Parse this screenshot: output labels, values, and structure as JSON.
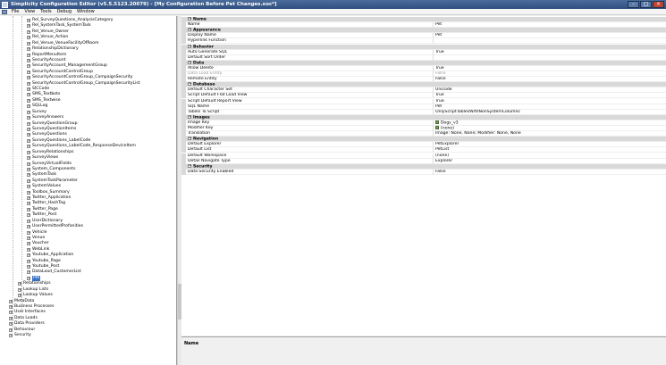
{
  "window": {
    "title": "Simplicity Configuration Editor (v5.5.5123.20079) - [My Configuration Before Pet Changes.xoc*]"
  },
  "menu": [
    "File",
    "View",
    "Tools",
    "Debug",
    "Window"
  ],
  "tree": {
    "tables": [
      "Rel_SurveyQuestions_AnalysisCategory",
      "Rel_SystemTask_SystemTask",
      "Rel_Venue_Owner",
      "Rel_Venue_Action",
      "Rel_Venue_VenueFacilityOfRoom",
      "RelationshipDictionary",
      "ReportMenuItem",
      "SecurityAccount",
      "SecurityAccount_ManagementGroup",
      "SecurityAccountControlGroup",
      "SecurityAccountControlGroup_CampaignSecurity",
      "SecurityAccountControlGroup_CampaignSecurityList",
      "SICCode",
      "SMS_Textbots",
      "SMS_Textwise",
      "SQLLog",
      "Survey",
      "SurveyAnswers",
      "SurveyQuestionGroup",
      "SurveyQuestionItems",
      "SurveyQuestions",
      "SurveyQuestions_LabelCode",
      "SurveyQuestions_LabelCode_ResponseDeviceItem",
      "SurveyRelationships",
      "SurveyViews",
      "SurveyVirtualFields",
      "System_Components",
      "SystemTask",
      "SystemTaskParameter",
      "SystemValues",
      "Toolbox_Summary",
      "Twitter_Application",
      "Twitter_HashTag",
      "Twitter_Page",
      "Twitter_Post",
      "UserDictionary",
      "UserPermittedProfanities",
      "Vehicle",
      "Venue",
      "Voucher",
      "WebLink",
      "Youtube_Application",
      "Youtube_Page",
      "Youtube_Post",
      "DataLoad_CustomerList",
      "Pet"
    ],
    "selected": "Pet",
    "groups": [
      "Relationships",
      "Lookup Lists",
      "Lookup Values"
    ],
    "root": [
      "MetaData",
      "Business Processes",
      "User Interfaces",
      "Data Loads",
      "Data Providers",
      "Behaviour",
      "Security"
    ]
  },
  "properties": [
    {
      "type": "cat",
      "label": "Name"
    },
    {
      "type": "prop",
      "label": "Name",
      "value": "Pet"
    },
    {
      "type": "cat",
      "label": "Appearance"
    },
    {
      "type": "prop",
      "label": "Display Name",
      "value": "Pet"
    },
    {
      "type": "prop",
      "label": "Hyperlink Function",
      "value": ""
    },
    {
      "type": "cat",
      "label": "Behavior"
    },
    {
      "type": "prop",
      "label": "Auto Generate SQL",
      "value": "True"
    },
    {
      "type": "prop",
      "label": "Default Sort Order",
      "value": ""
    },
    {
      "type": "cat",
      "label": "Data"
    },
    {
      "type": "prop",
      "label": "Allow Delete",
      "value": "True"
    },
    {
      "type": "prop",
      "label": "Data Load Entity",
      "value": "False",
      "disabled": true
    },
    {
      "type": "prop",
      "label": "Remote Entity",
      "value": "False"
    },
    {
      "type": "cat",
      "label": "Database"
    },
    {
      "type": "prop",
      "label": "Default Character Set",
      "value": "Unicode"
    },
    {
      "type": "prop",
      "label": "Script Default Flat Load View",
      "value": "True"
    },
    {
      "type": "prop",
      "label": "Script Default Report View",
      "value": "True"
    },
    {
      "type": "prop",
      "label": "SQL Name",
      "value": "Pet"
    },
    {
      "type": "prop",
      "label": "Tables To Script",
      "value": "OnlyScriptTablesWithNonSystemColumns"
    },
    {
      "type": "cat",
      "label": "Images"
    },
    {
      "type": "prop",
      "label": "Image Key",
      "value": "Dogs_v3",
      "icon": true
    },
    {
      "type": "prop",
      "label": "Modifier Key",
      "value": "(none)",
      "icon": true
    },
    {
      "type": "prop",
      "label": "Translation",
      "value": "Image: None, None; Modifier: None, None"
    },
    {
      "type": "cat",
      "label": "Navigation"
    },
    {
      "type": "prop",
      "label": "Default Explorer",
      "value": "PetExplorer"
    },
    {
      "type": "prop",
      "label": "Default List",
      "value": "PetList"
    },
    {
      "type": "prop",
      "label": "Default Workspace",
      "value": "(none)"
    },
    {
      "type": "prop",
      "label": "Detail Navigate Type",
      "value": "Explorer"
    },
    {
      "type": "cat",
      "label": "Security"
    },
    {
      "type": "prop",
      "label": "Data Security Enabled",
      "value": "False"
    }
  ],
  "description": {
    "title": "Name"
  }
}
